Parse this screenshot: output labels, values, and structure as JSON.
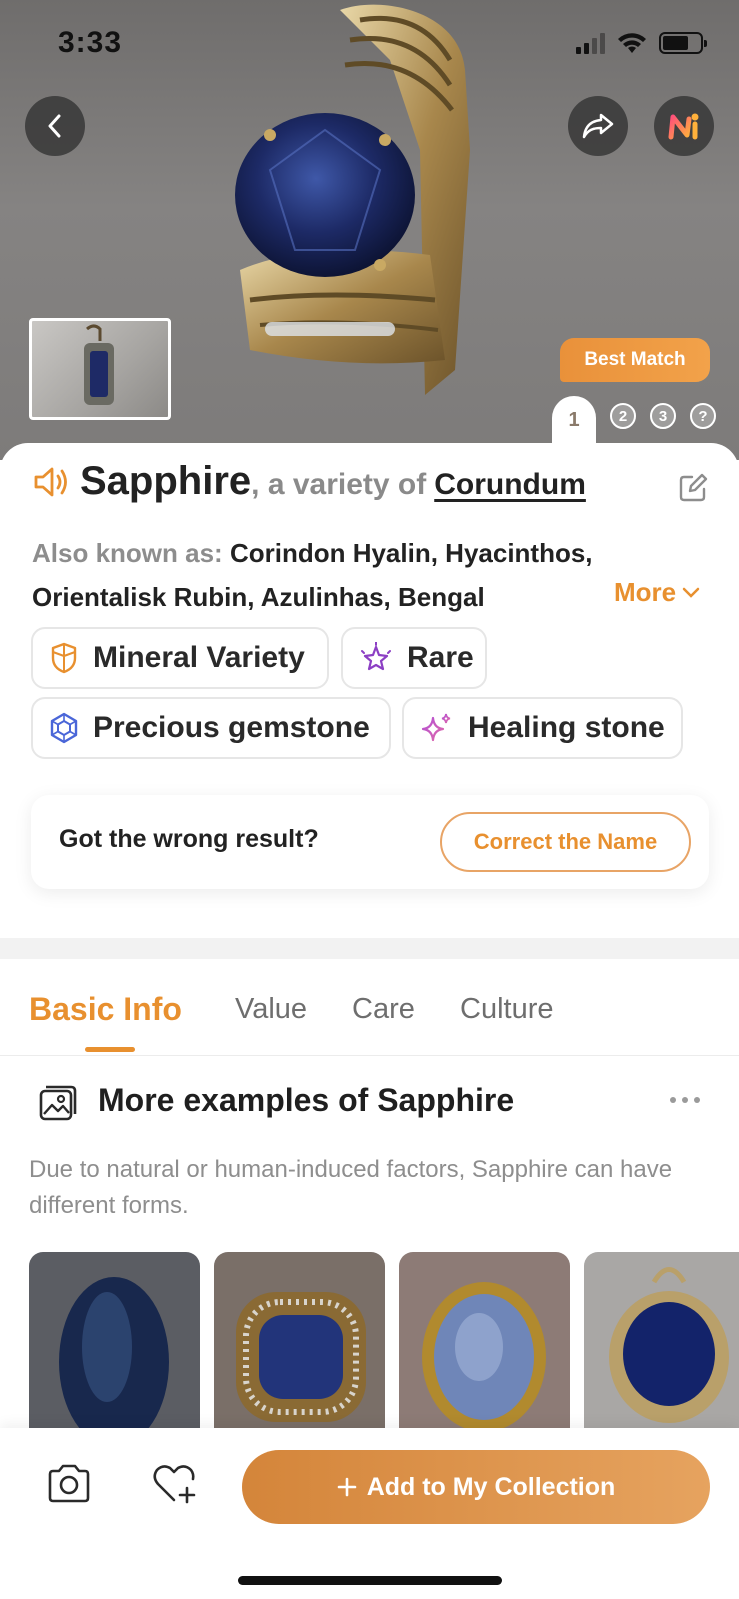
{
  "status_bar": {
    "time": "3:33"
  },
  "hero": {
    "best_match_label": "Best Match",
    "pages": [
      "1",
      "2",
      "3",
      "?"
    ]
  },
  "result": {
    "name": "Sapphire",
    "variety_prefix": ", a variety of",
    "parent_mineral": "Corundum",
    "aka_label": "Also known as:",
    "aka_values": "Corindon Hyalin, Hyacinthos, Orientalisk Rubin, Azulinhas, Bengal",
    "more_label": "More"
  },
  "chips": [
    {
      "label": "Mineral Variety",
      "icon": "gem-shield-icon"
    },
    {
      "label": "Rare",
      "icon": "sparkle-star-icon"
    },
    {
      "label": "Precious gemstone",
      "icon": "hexagon-gem-icon"
    },
    {
      "label": "Healing stone",
      "icon": "sparkles-icon"
    }
  ],
  "feedback": {
    "question": "Got the wrong result?",
    "button_label": "Correct the Name"
  },
  "tabs": [
    {
      "label": "Basic Info",
      "active": true
    },
    {
      "label": "Value"
    },
    {
      "label": "Care"
    },
    {
      "label": "Culture"
    }
  ],
  "examples_section": {
    "title": "More examples of Sapphire",
    "description": "Due to natural or human-induced factors, Sapphire can have different forms."
  },
  "bottom_bar": {
    "add_label": "Add to My Collection"
  },
  "colors": {
    "accent": "#e8902f",
    "hero_bg": "#7f7d7c"
  }
}
